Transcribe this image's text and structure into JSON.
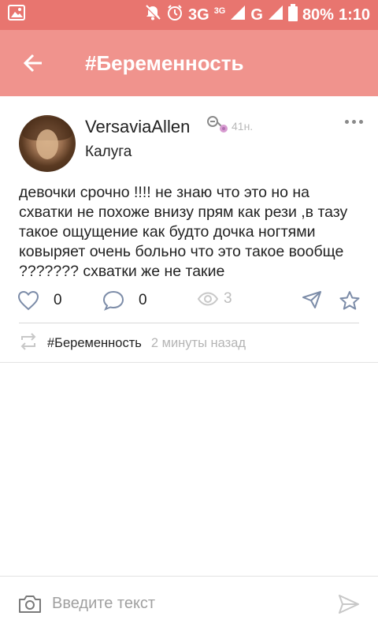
{
  "status_bar": {
    "network_primary": "3G",
    "network_small": "3G",
    "network_secondary": "G",
    "battery": "80%",
    "time": "1:10"
  },
  "app_bar": {
    "title": "#Беременность"
  },
  "post": {
    "author": "VersaviaAllen",
    "age": "41н.",
    "city": "Калуга",
    "text": "девочки срочно !!!! не знаю что это но на схватки не похоже внизу прям как рези ,в тазу такое ощущение как будто дочка ногтями ковыряет очень больно что это такое вообще ??????? схватки же не такие",
    "likes": "0",
    "comments": "0",
    "views": "3",
    "tag": "#Беременность",
    "time_ago": "2 минуты назад"
  },
  "composer": {
    "placeholder": "Введите текст"
  },
  "colors": {
    "status_bar": "#e8756f",
    "app_bar": "#f0938d"
  }
}
